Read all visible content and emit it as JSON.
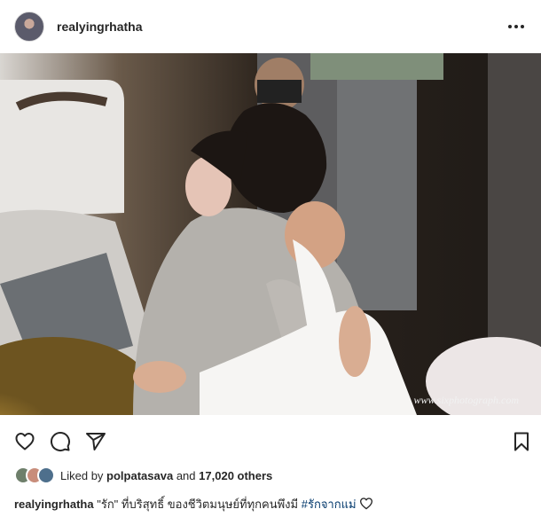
{
  "header": {
    "username": "realyingrhatha",
    "avatar_icon": "profile-avatar",
    "more_icon": "more-horizontal-icon"
  },
  "photo": {
    "alt": "Two women embracing in a hug",
    "watermark": "www.sixphotograph.com"
  },
  "actions": {
    "like_icon": "heart-outline-icon",
    "comment_icon": "comment-icon",
    "share_icon": "share-paper-plane-icon",
    "save_icon": "bookmark-icon"
  },
  "likes": {
    "prefix": "Liked by",
    "user": "polpatasava",
    "middle": "and",
    "count": "17,020 others"
  },
  "caption": {
    "username": "realyingrhatha",
    "text": "\"รัก\" ที่บริสุทธิ์ ของชีวิตมนุษย์ที่ทุกคนพึงมี",
    "hashtag": "#รักจากแม่",
    "emoji": "heart-outline-icon"
  },
  "colors": {
    "text": "#262626",
    "link": "#00376b",
    "border": "#dbdbdb"
  }
}
